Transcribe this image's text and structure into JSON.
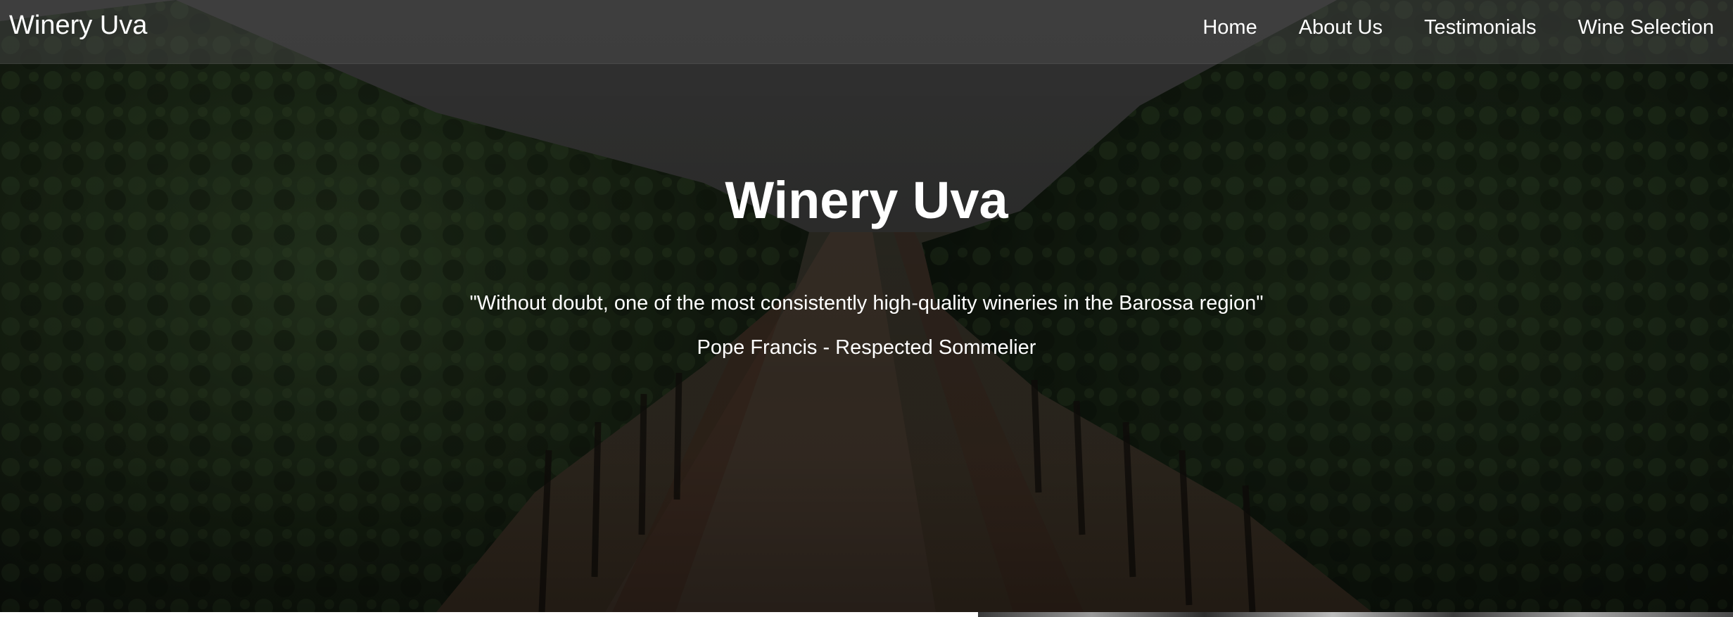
{
  "navbar": {
    "brand": "Winery Uva",
    "links": [
      "Home",
      "About Us",
      "Testimonials",
      "Wine Selection"
    ]
  },
  "hero": {
    "title": "Winery Uva",
    "quote": "\"Without doubt, one of the most consistently high-quality wineries in the Barossa region\"",
    "attribution": "Pope Francis - Respected Sommelier",
    "background_image": "vineyard-rows-photo"
  },
  "colors": {
    "text": "#ffffff",
    "overlay": "#000000",
    "navbar_background": "#505050",
    "foliage": "#2f4523",
    "soil": "#5a4232",
    "sky": "#3f3f3f"
  }
}
